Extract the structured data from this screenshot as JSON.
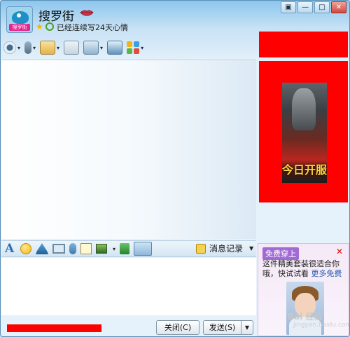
{
  "title": {
    "avatar_text": "搜罗街",
    "name": "搜罗街",
    "signature": "已经连续写24天心情"
  },
  "window_buttons": [
    "▣",
    "—",
    "□",
    "✕"
  ],
  "toolbar": {
    "items": [
      "webcam-icon",
      "mic-icon",
      "transfer-icon",
      "chat-add-icon",
      "remote-icon",
      "screen-icon",
      "apps-icon"
    ]
  },
  "ad": {
    "game_text": "今日开服"
  },
  "input_toolbar": {
    "font_icon": "A",
    "history_label": "消息记录",
    "history_arrow": "▼"
  },
  "buttons": {
    "close_label": "关闭(C)",
    "send_label": "发送(S)",
    "send_arrow": "▼"
  },
  "promo": {
    "badge": "免费穿上",
    "close": "✕",
    "text": "这件精美套装很适合你哦，快试试看",
    "link": "更多免费",
    "watermark": "Bai 经验",
    "watermark_sub": "jingyan.baidu.com"
  },
  "colors": {
    "ad_red": "#ff0000",
    "accent": "#2c6fb3"
  }
}
